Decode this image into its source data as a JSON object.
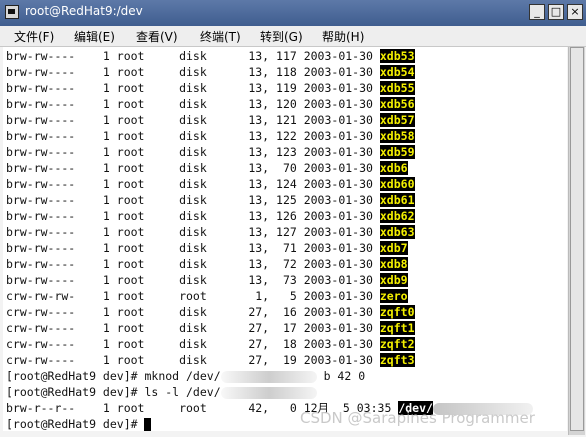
{
  "window": {
    "title": "root@RedHat9:/dev",
    "minimize_label": "_",
    "maximize_label": "□",
    "close_label": "×"
  },
  "menu": {
    "items": [
      "文件(F)",
      "编辑(E)",
      "查看(V)",
      "终端(T)",
      "转到(G)",
      "帮助(H)"
    ]
  },
  "listing": [
    {
      "prefix": "brw-rw----    1 root     disk      13, 117 2003-01-30 ",
      "name": "xdb53"
    },
    {
      "prefix": "brw-rw----    1 root     disk      13, 118 2003-01-30 ",
      "name": "xdb54"
    },
    {
      "prefix": "brw-rw----    1 root     disk      13, 119 2003-01-30 ",
      "name": "xdb55"
    },
    {
      "prefix": "brw-rw----    1 root     disk      13, 120 2003-01-30 ",
      "name": "xdb56"
    },
    {
      "prefix": "brw-rw----    1 root     disk      13, 121 2003-01-30 ",
      "name": "xdb57"
    },
    {
      "prefix": "brw-rw----    1 root     disk      13, 122 2003-01-30 ",
      "name": "xdb58"
    },
    {
      "prefix": "brw-rw----    1 root     disk      13, 123 2003-01-30 ",
      "name": "xdb59"
    },
    {
      "prefix": "brw-rw----    1 root     disk      13,  70 2003-01-30 ",
      "name": "xdb6"
    },
    {
      "prefix": "brw-rw----    1 root     disk      13, 124 2003-01-30 ",
      "name": "xdb60"
    },
    {
      "prefix": "brw-rw----    1 root     disk      13, 125 2003-01-30 ",
      "name": "xdb61"
    },
    {
      "prefix": "brw-rw----    1 root     disk      13, 126 2003-01-30 ",
      "name": "xdb62"
    },
    {
      "prefix": "brw-rw----    1 root     disk      13, 127 2003-01-30 ",
      "name": "xdb63"
    },
    {
      "prefix": "brw-rw----    1 root     disk      13,  71 2003-01-30 ",
      "name": "xdb7"
    },
    {
      "prefix": "brw-rw----    1 root     disk      13,  72 2003-01-30 ",
      "name": "xdb8"
    },
    {
      "prefix": "brw-rw----    1 root     disk      13,  73 2003-01-30 ",
      "name": "xdb9"
    },
    {
      "prefix": "crw-rw-rw-    1 root     root       1,   5 2003-01-30 ",
      "name": "zero"
    },
    {
      "prefix": "crw-rw----    1 root     disk      27,  16 2003-01-30 ",
      "name": "zqft0"
    },
    {
      "prefix": "crw-rw----    1 root     disk      27,  17 2003-01-30 ",
      "name": "zqft1"
    },
    {
      "prefix": "crw-rw----    1 root     disk      27,  18 2003-01-30 ",
      "name": "zqft2"
    },
    {
      "prefix": "crw-rw----    1 root     disk      27,  19 2003-01-30 ",
      "name": "zqft3"
    }
  ],
  "commands": {
    "mknod_prefix": "[root@RedHat9 dev]# mknod /dev/",
    "mknod_suffix": "b 42 0",
    "ls_prefix": "[root@RedHat9 dev]# ls -l /dev/",
    "result_prefix": "brw-r--r--    1 root     root      42,   0 12月  5 03:35 ",
    "result_name": "/dev/",
    "final_prompt": "[root@RedHat9 dev]# "
  },
  "watermark": "CSDN @Sarapines Programmer",
  "colors": {
    "title_bar": "#4a679a",
    "highlight_bg": "#000000",
    "highlight_fg": "#f4f000"
  }
}
